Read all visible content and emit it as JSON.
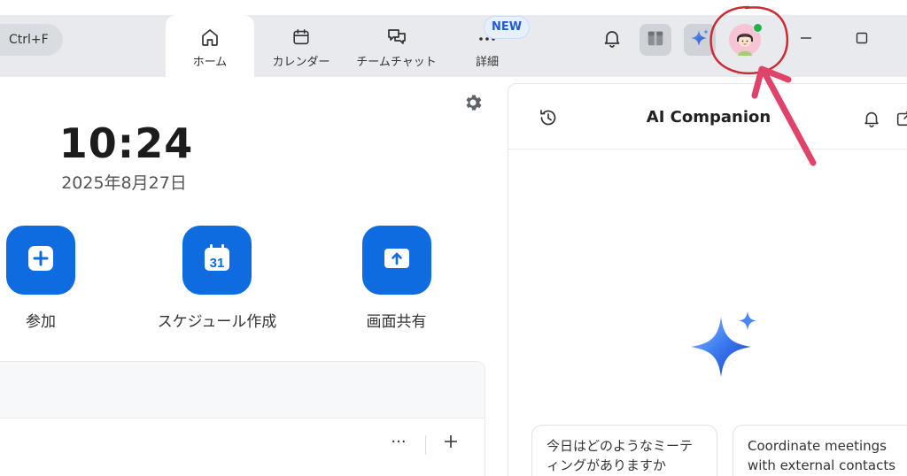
{
  "search": {
    "shortcut": "Ctrl+F"
  },
  "tabs": [
    {
      "id": "home",
      "label": "ホーム",
      "icon": "home-icon",
      "active": true
    },
    {
      "id": "calendar",
      "label": "カレンダー",
      "icon": "calendar-icon"
    },
    {
      "id": "team_chat",
      "label": "チームチャット",
      "icon": "chat-icon"
    },
    {
      "id": "more",
      "label": "詳細",
      "icon": "more-icon",
      "badge": "NEW"
    }
  ],
  "home": {
    "time": "10:24",
    "date": "2025年8月27日",
    "actions": [
      {
        "id": "join",
        "label": "参加",
        "icon": "plus-icon"
      },
      {
        "id": "schedule",
        "label": "スケジュール作成",
        "icon": "calendar-31-icon",
        "day": "31"
      },
      {
        "id": "share",
        "label": "画面共有",
        "icon": "share-screen-icon"
      }
    ],
    "card": {
      "more_label": "···"
    }
  },
  "ai_companion": {
    "title": "AI Companion",
    "suggestions": [
      "今日はどのようなミーティングがありますか",
      "Coordinate meetings with external contacts"
    ]
  },
  "colors": {
    "accent": "#0e6ce0",
    "topbar_bg": "#e8eaee",
    "status_online": "#22b14c",
    "annotation": "#e0426a"
  }
}
